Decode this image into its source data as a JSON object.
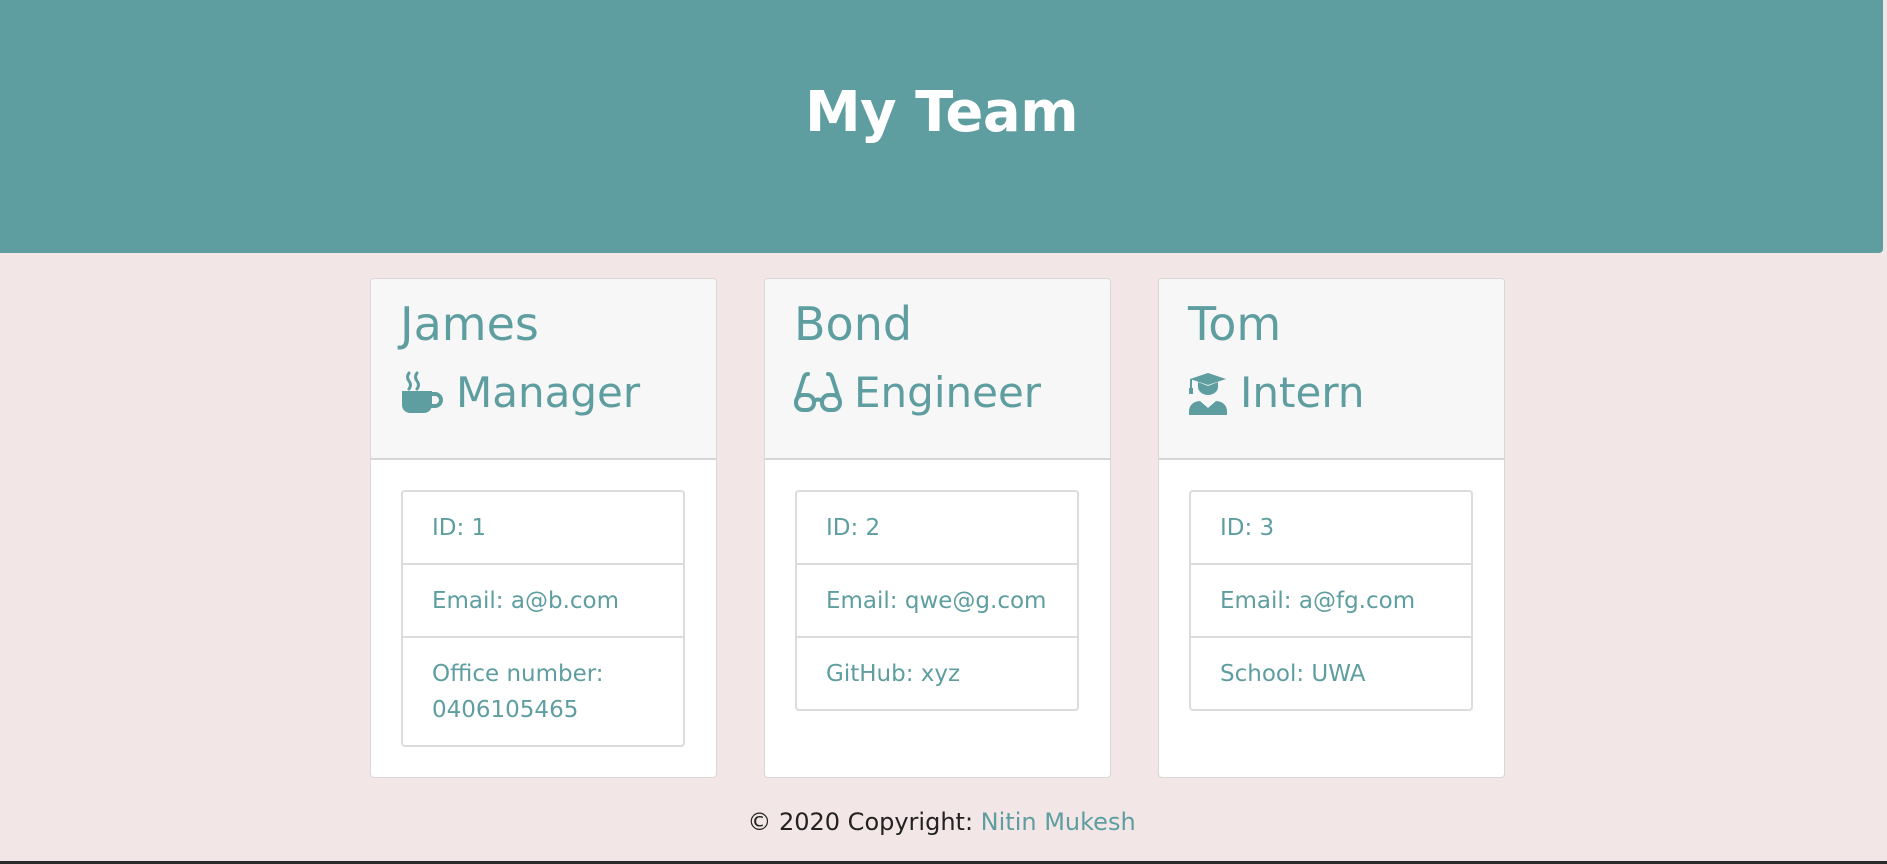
{
  "header": {
    "title": "My Team"
  },
  "team": [
    {
      "name": "James",
      "role": "Manager",
      "role_icon": "coffee-mug-icon",
      "details": [
        "ID: 1",
        "Email: a@b.com",
        "Office number: 0406105465"
      ]
    },
    {
      "name": "Bond",
      "role": "Engineer",
      "role_icon": "glasses-icon",
      "details": [
        "ID: 2",
        "Email: qwe@g.com",
        "GitHub: xyz"
      ]
    },
    {
      "name": "Tom",
      "role": "Intern",
      "role_icon": "graduate-icon",
      "details": [
        "ID: 3",
        "Email: a@fg.com",
        "School: UWA"
      ]
    }
  ],
  "footer": {
    "copyright": "© 2020 Copyright: ",
    "author_link": "Nitin Mukesh"
  },
  "colors": {
    "accent": "#5f9ea0",
    "background": "#f3e6e7"
  }
}
